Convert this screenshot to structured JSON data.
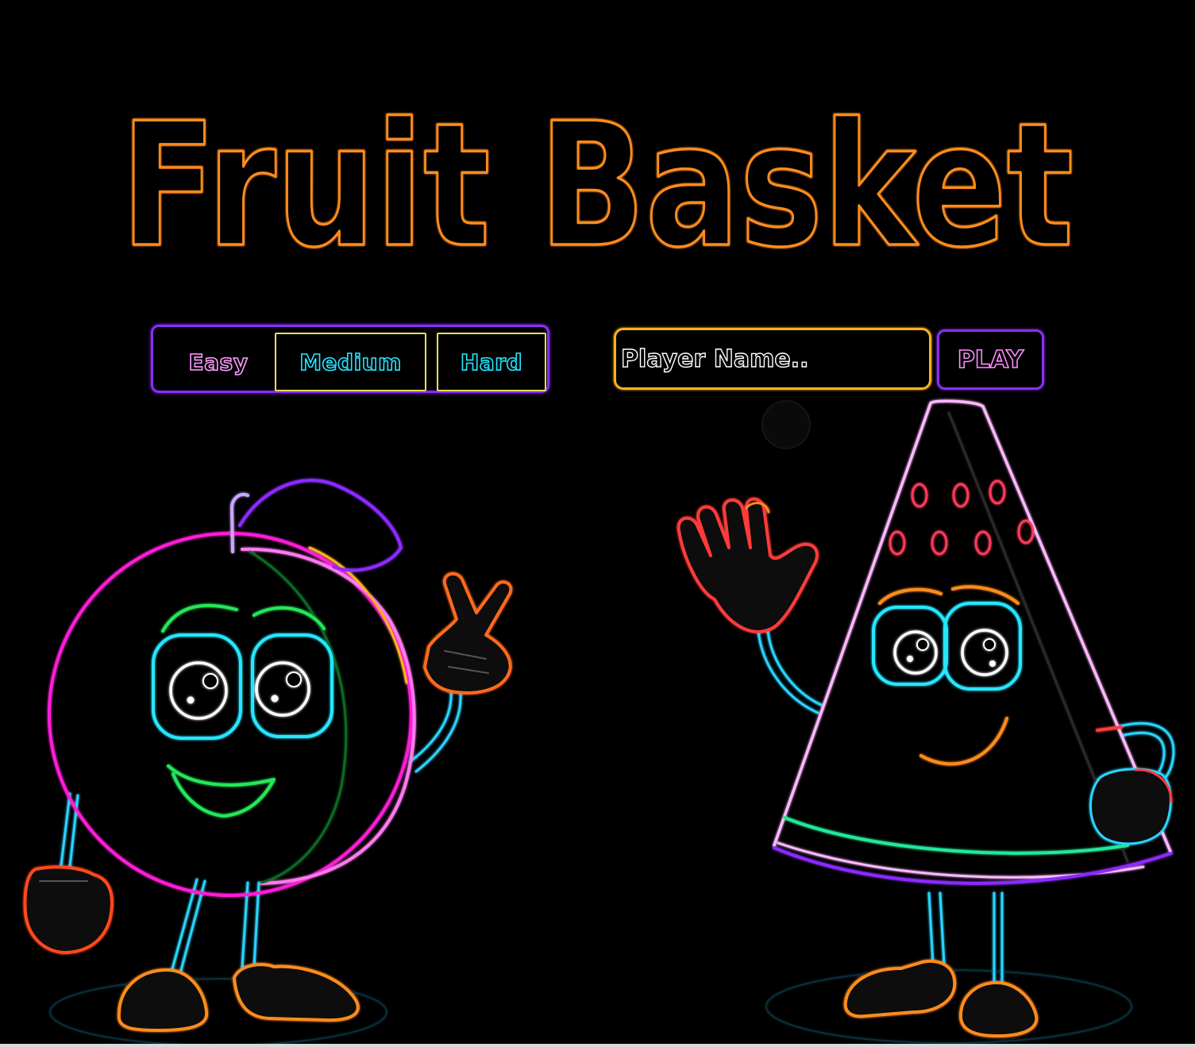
{
  "game": {
    "title": "Fruit Basket"
  },
  "difficulty": {
    "easy_label": "Easy",
    "medium_label": "Medium",
    "hard_label": "Hard"
  },
  "player": {
    "placeholder": "Player Name..",
    "value": ""
  },
  "play_button_label": "PLAY",
  "characters": {
    "left": "apple-icon",
    "right": "watermelon-slice-icon"
  },
  "colors": {
    "background": "#000000",
    "title_stroke": "#ff8c1a",
    "panel_border_purple": "#8c2cff",
    "input_border_orange": "#ffb21c",
    "button_border_yellow": "#e6e05a",
    "easy_text": "#ff9cff",
    "medium_hard_text": "#25e6ff",
    "play_text": "#ff8cff",
    "limb_cyan": "#2ad4ff"
  }
}
